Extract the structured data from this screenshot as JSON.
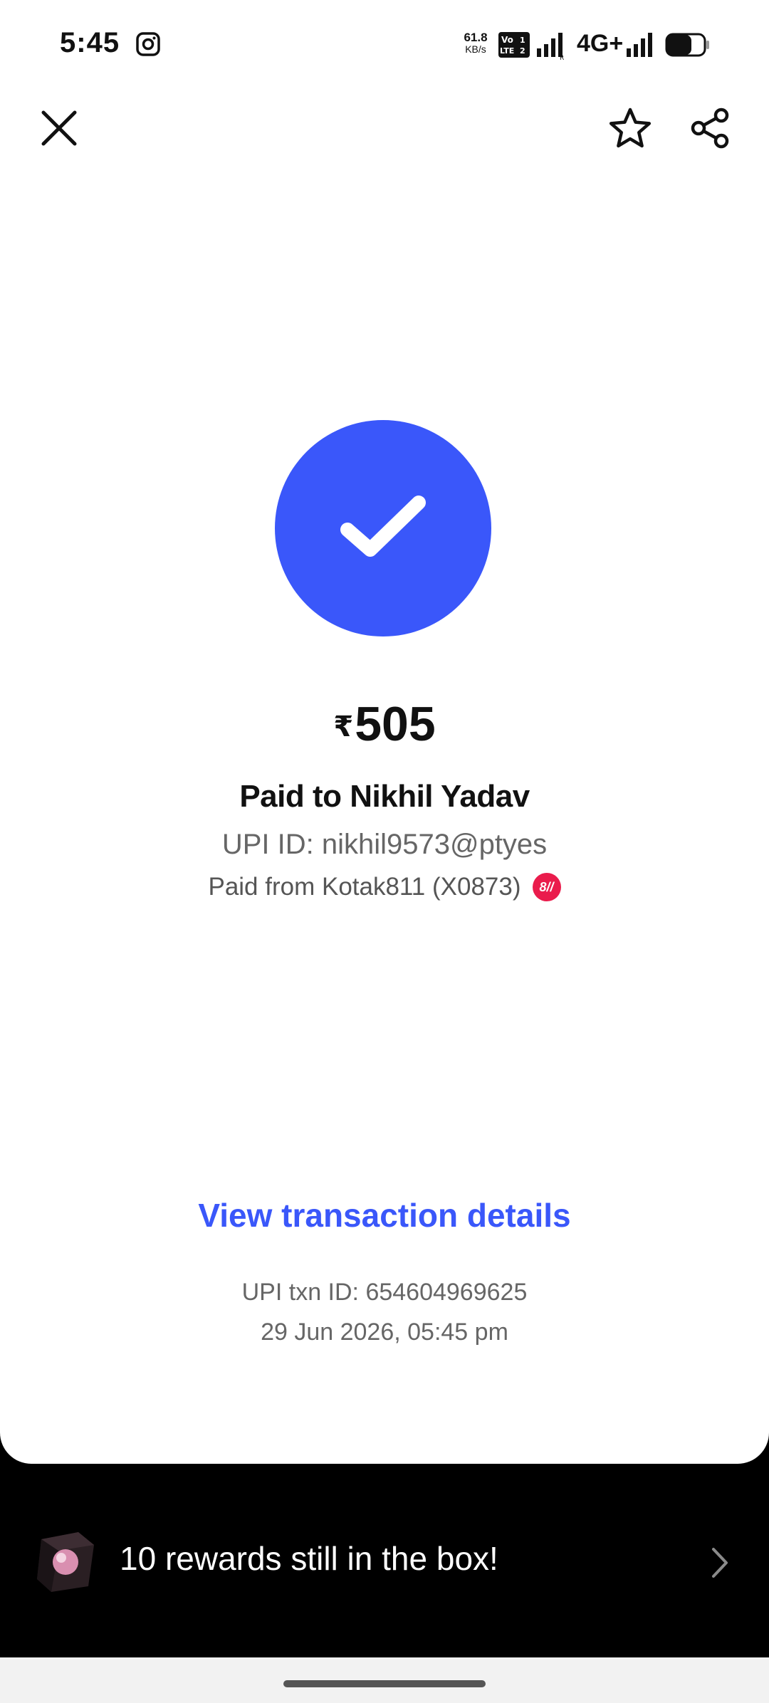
{
  "status_bar": {
    "time": "5:45",
    "speed_value": "61.8",
    "speed_unit": "KB/s",
    "network_type": "4G+",
    "icons": [
      "instagram-icon",
      "volte-icon",
      "signal-icon",
      "signal-icon",
      "battery-icon"
    ]
  },
  "header": {
    "close_icon": "close-icon",
    "favorite_icon": "star-icon",
    "share_icon": "share-icon"
  },
  "payment": {
    "status_icon": "check-icon",
    "currency_symbol": "₹",
    "amount": "505",
    "payee_line": "Paid to Nikhil Yadav",
    "upi_id_line": "UPI ID: nikhil9573@ptyes",
    "paid_from_line": "Paid from Kotak811 (X0873)",
    "bank_logo_text": "8//"
  },
  "details": {
    "view_details_label": "View transaction details",
    "txn_id_line": "UPI txn ID: 654604969625",
    "date_line": "29 Jun 2026, 05:45 pm"
  },
  "rewards": {
    "label": "10 rewards still in the box!",
    "icon": "gift-box-icon",
    "chevron_icon": "chevron-right-icon"
  },
  "colors": {
    "accent": "#3a57fa",
    "background_card": "#ffffff",
    "background_bottom": "#000000",
    "bank_brand": "#ea1c4c"
  }
}
